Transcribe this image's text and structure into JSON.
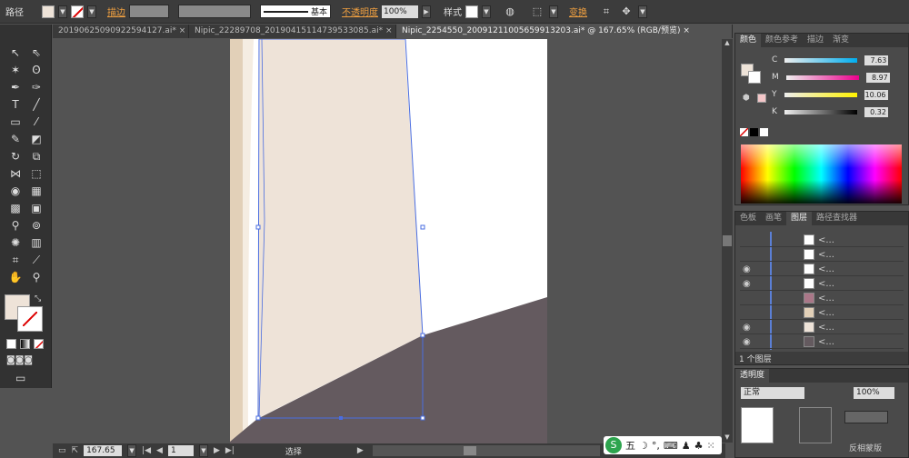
{
  "control_bar": {
    "object_type": "路径",
    "stroke_label": "描边",
    "opacity_label": "不透明度",
    "opacity_value": "100%",
    "stroke_style": "基本",
    "style_label": "样式",
    "transform_label": "变换"
  },
  "tabs": [
    "20190625090922594127.ai*",
    "Nipic_22289708_20190415114739533085.ai*",
    "Nipic_2254550_20091211005659913203.ai* @ 167.65% (RGB/预览)"
  ],
  "color_panel": {
    "tabs": [
      "颜色",
      "颜色参考",
      "描边",
      "渐变"
    ],
    "channels": [
      {
        "name": "C",
        "value": "7.63"
      },
      {
        "name": "M",
        "value": "8.97"
      },
      {
        "name": "Y",
        "value": "10.06"
      },
      {
        "name": "K",
        "value": "0.32"
      }
    ]
  },
  "layers_panel": {
    "tabs": [
      "色板",
      "画笔",
      "图层",
      "路径查找器"
    ],
    "count_label": "1 个图层",
    "row_label": "<..."
  },
  "transparency_panel": {
    "title": "透明度",
    "mode": "正常",
    "opacity": "100%",
    "reverse_mask": "反相蒙版"
  },
  "status_bar": {
    "zoom": "167.65",
    "page": "1",
    "tool": "选择"
  },
  "colors": {
    "panel_bg": "#4a4a4a",
    "artboard": "#ffffff",
    "beige": "#eee3d8",
    "dark": "#645a5f"
  }
}
